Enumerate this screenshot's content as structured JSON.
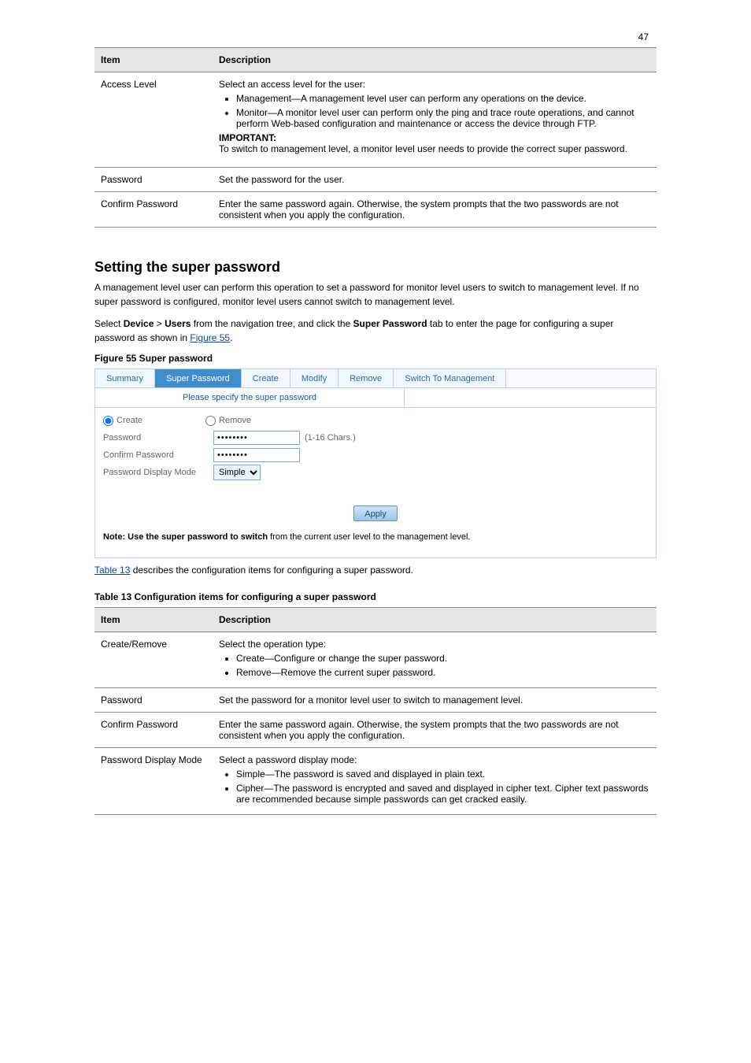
{
  "page_number": "47",
  "table1": {
    "header_item": "Item",
    "header_desc": "Description",
    "rows": [
      {
        "item": "Access Level",
        "desc": {
          "intro": "Select an access level for the user:",
          "bullets": [
            "Management—A management level user can perform any operations on the device.",
            "Monitor—A monitor level user can perform only the ping and trace route operations, and cannot perform Web-based configuration and maintenance or access the device through FTP."
          ],
          "important_head": "IMPORTANT:",
          "important_text": "To switch to management level, a monitor level user needs to provide the correct super password."
        }
      },
      {
        "item": "Password",
        "desc": "Set the password for the user."
      },
      {
        "item": "Confirm Password",
        "desc": "Enter the same password again. Otherwise, the system prompts that the two passwords are not consistent when you apply the configuration."
      }
    ]
  },
  "section_title": "Setting the super password",
  "section_p1_a": "A management level user can perform this operation to set a password for monitor level users to switch to management level. If no super password is configured, monitor level users cannot switch to management level.",
  "section_p2_a": "Select ",
  "section_p2_b": "Device",
  "section_p2_c": " > ",
  "section_p2_d": "Users",
  "section_p2_e": " from the navigation tree, and click the ",
  "section_p2_f": "Super Password",
  "section_p2_g": " tab to enter the page for configuring a super password as shown in ",
  "section_p2_link1": "Figure 55",
  "section_p2_h": ".",
  "figure_label": "Figure 55 Super password",
  "screenshot": {
    "tabs": [
      "Summary",
      "Super Password",
      "Create",
      "Modify",
      "Remove",
      "Switch To Management"
    ],
    "active_tab_index": 1,
    "section_title": "Please specify the super password",
    "radios": {
      "create": "Create",
      "remove": "Remove"
    },
    "labels": {
      "password": "Password",
      "confirm": "Confirm Password",
      "display_mode": "Password Display Mode"
    },
    "hint": "(1-16 Chars.)",
    "select_value": "Simple",
    "apply": "Apply",
    "note_bold": "Note: Use the super password to switch",
    "note_rest": " from the current user level to the management level."
  },
  "link_table2": "Table 13",
  "p3_a": " describes the configuration items for configuring a super password.",
  "table2_label": "Table 13 Configuration items for configuring a super password",
  "table2": {
    "header_item": "Item",
    "header_desc": "Description",
    "rows": [
      {
        "item": "Create/Remove",
        "intro": "Select the operation type:",
        "bullets": [
          "Create—Configure or change the super password.",
          "Remove—Remove the current super password."
        ]
      },
      {
        "item": "Password",
        "desc": "Set the password for a monitor level user to switch to management level."
      },
      {
        "item": "Confirm Password",
        "desc": "Enter the same password again. Otherwise, the system prompts that the two passwords are not consistent when you apply the configuration."
      },
      {
        "item": "Password Display Mode",
        "intro": "Select a password display mode:",
        "bullets": [
          "Simple—The password is saved and displayed in plain text.",
          "Cipher—The password is encrypted and saved and displayed in cipher text. Cipher text passwords are recommended because simple passwords can get cracked easily."
        ]
      }
    ]
  }
}
